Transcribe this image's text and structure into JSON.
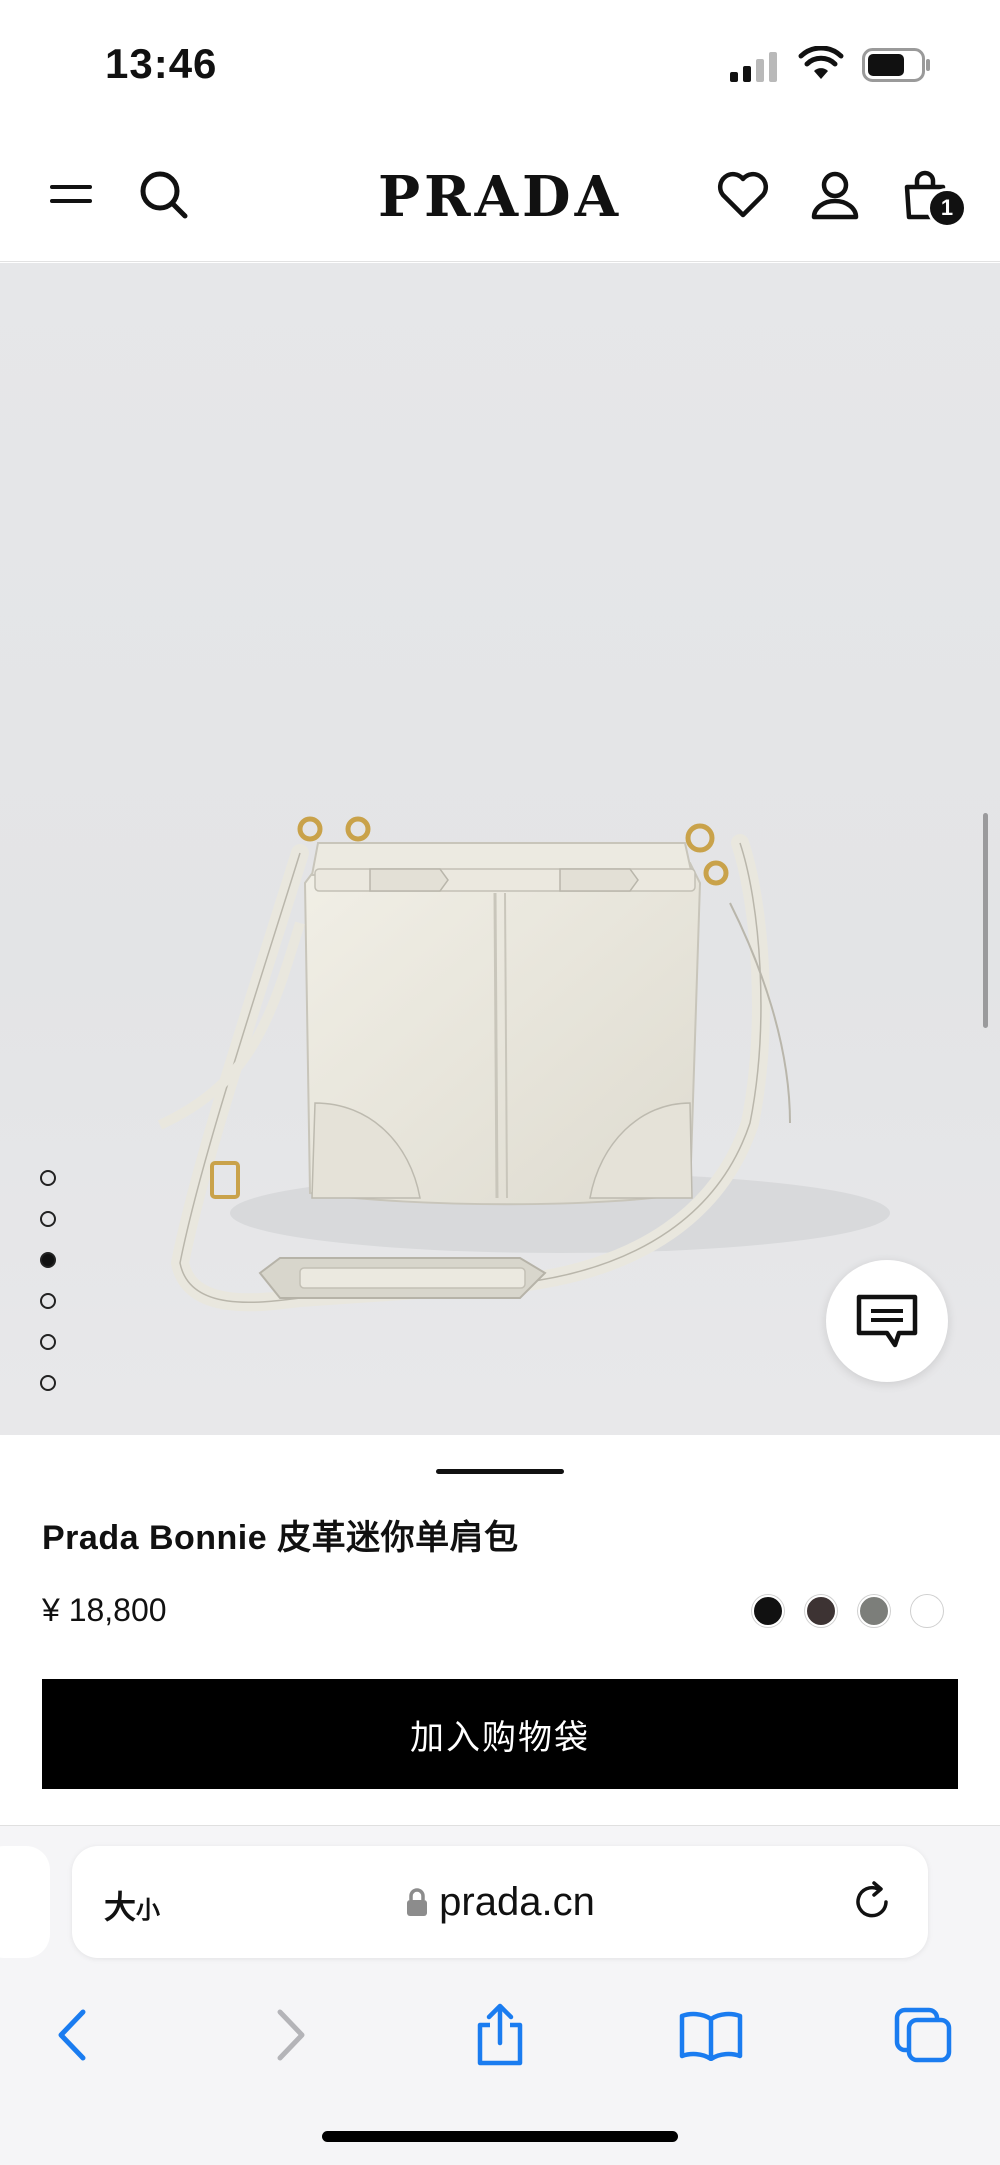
{
  "status_bar": {
    "time": "13:46"
  },
  "header": {
    "logo": "PRADA",
    "cart_count": "1"
  },
  "icons": {
    "menu": "menu-icon",
    "search": "search-icon",
    "wishlist": "heart-icon",
    "account": "user-icon",
    "cart": "shopping-bag-icon",
    "chat": "chat-icon",
    "lock": "lock-icon",
    "reload": "reload-icon",
    "back": "chevron-left-icon",
    "forward": "chevron-right-icon",
    "share": "share-icon",
    "bookmarks": "book-icon",
    "tabs": "tabs-icon"
  },
  "gallery": {
    "image_count": 6,
    "active_index": 2
  },
  "product": {
    "title": "Prada Bonnie 皮革迷你单肩包",
    "price": "¥ 18,800",
    "color_swatches": [
      "#111111",
      "#3d3333",
      "#7c7e7a",
      "#ffffff"
    ],
    "selected_swatch": 3,
    "add_to_bag_label": "加入购物袋"
  },
  "browser": {
    "text_size_label": "大",
    "text_size_small": "小",
    "url": "prada.cn"
  },
  "colors": {
    "accent_ios": "#1a7cf0",
    "button_bg": "#000000"
  }
}
